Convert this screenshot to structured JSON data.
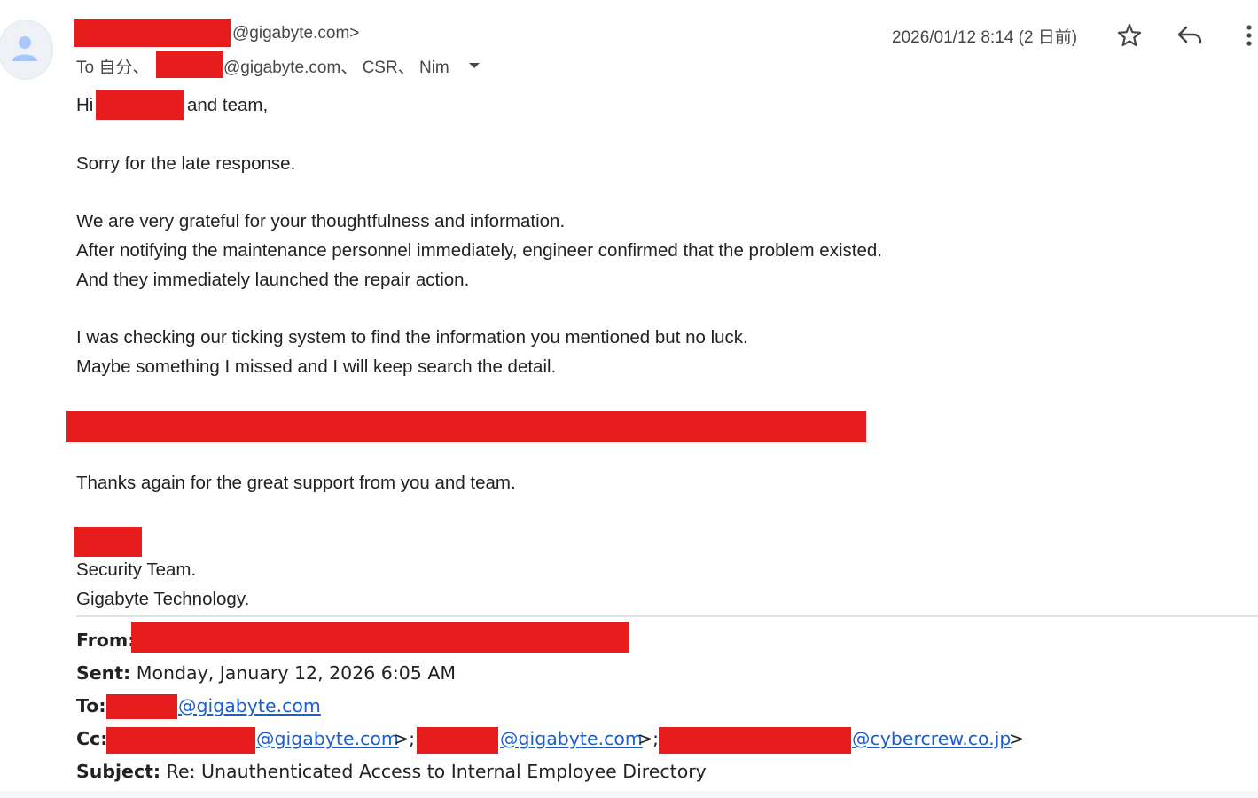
{
  "header": {
    "from_suffix": "@gigabyte.com>",
    "to_prefix": "To 自分、",
    "to_suffix": "@gigabyte.com、 CSR、 Nim",
    "date": "2026/01/12 8:14 (2 日前)"
  },
  "icons": {
    "avatar": "person-icon",
    "star": "star-icon",
    "reply": "reply-icon",
    "more": "more-vertical-icon",
    "recipients": "chevron-down-icon"
  },
  "body": {
    "greet_hi": "Hi",
    "greet_rest": "and team,",
    "p1": "Sorry for the late response.",
    "p2_l1": "We are very grateful for your thoughtfulness and information.",
    "p2_l2": "After notifying the maintenance personnel immediately, engineer confirmed that the problem existed.",
    "p2_l3": "And they immediately launched the repair action.",
    "p3_l1": "I was checking our ticking system to find the information you mentioned but no luck.",
    "p3_l2": "Maybe something I missed and I will keep search the detail.",
    "p4": "Thanks again for the great support from you and team.",
    "sig_team": "Security Team.",
    "sig_company": "Gigabyte Technology."
  },
  "quoted": {
    "from_label": "From:",
    "sent_label": "Sent:",
    "sent_value": "Monday, January 12, 2026 6:05 AM",
    "to_label": "To:",
    "to_link": "@gigabyte.com",
    "cc_label": "Cc:",
    "cc_link1": "@gigabyte.com",
    "cc_sep1": ">;",
    "cc_link2": "@gigabyte.com",
    "cc_sep2": ">;",
    "cc_link3": "@cybercrew.co.jp",
    "cc_end": ">",
    "subject_label": "Subject:",
    "subject_value": "Re: Unauthenticated Access to Internal Employee Directory"
  },
  "colors": {
    "redaction": "#e71c1c",
    "link": "#1a5fd1"
  }
}
